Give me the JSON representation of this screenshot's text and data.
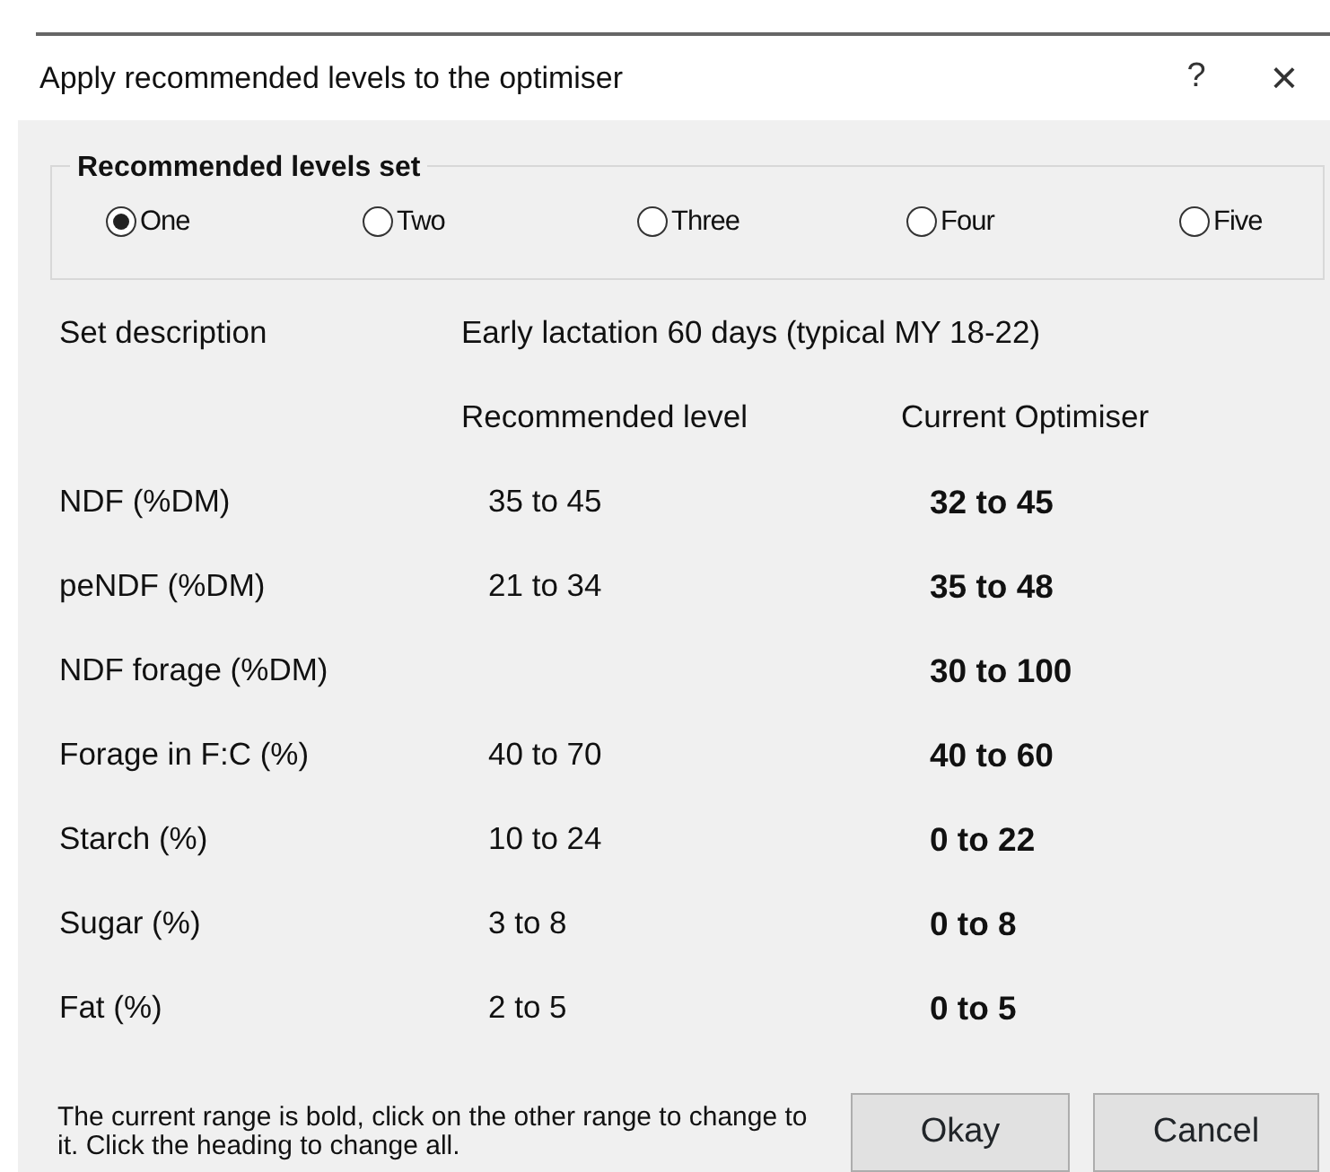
{
  "window": {
    "title": "Apply recommended levels to the optimiser",
    "help": "?",
    "close": "×"
  },
  "levels_set": {
    "title": "Recommended levels set",
    "options": [
      {
        "label": "One",
        "selected": true
      },
      {
        "label": "Two",
        "selected": false
      },
      {
        "label": "Three",
        "selected": false
      },
      {
        "label": "Four",
        "selected": false
      },
      {
        "label": "Five",
        "selected": false
      }
    ]
  },
  "set_description": {
    "label": "Set description",
    "value": "Early lactation 60 days (typical MY 18-22)"
  },
  "columns": [
    "Recommended level",
    "Current Optimiser"
  ],
  "rows": [
    {
      "name": "NDF (%DM)",
      "recommended": "35 to 45",
      "current": "32 to 45"
    },
    {
      "name": "peNDF (%DM)",
      "recommended": "21 to 34",
      "current": "35 to 48"
    },
    {
      "name": "NDF forage (%DM)",
      "recommended": "",
      "current": "30 to 100"
    },
    {
      "name": "Forage in F:C (%)",
      "recommended": "40 to 70",
      "current": "40 to 60"
    },
    {
      "name": "Starch (%)",
      "recommended": "10 to 24",
      "current": "0 to 22"
    },
    {
      "name": "Sugar (%)",
      "recommended": "3 to 8",
      "current": "0 to 8"
    },
    {
      "name": "Fat (%)",
      "recommended": "2 to 5",
      "current": "0 to 5"
    }
  ],
  "hint": "The current range is bold, click on the other range to change to it. Click the heading to change all.",
  "buttons": [
    "Okay",
    "Cancel"
  ]
}
